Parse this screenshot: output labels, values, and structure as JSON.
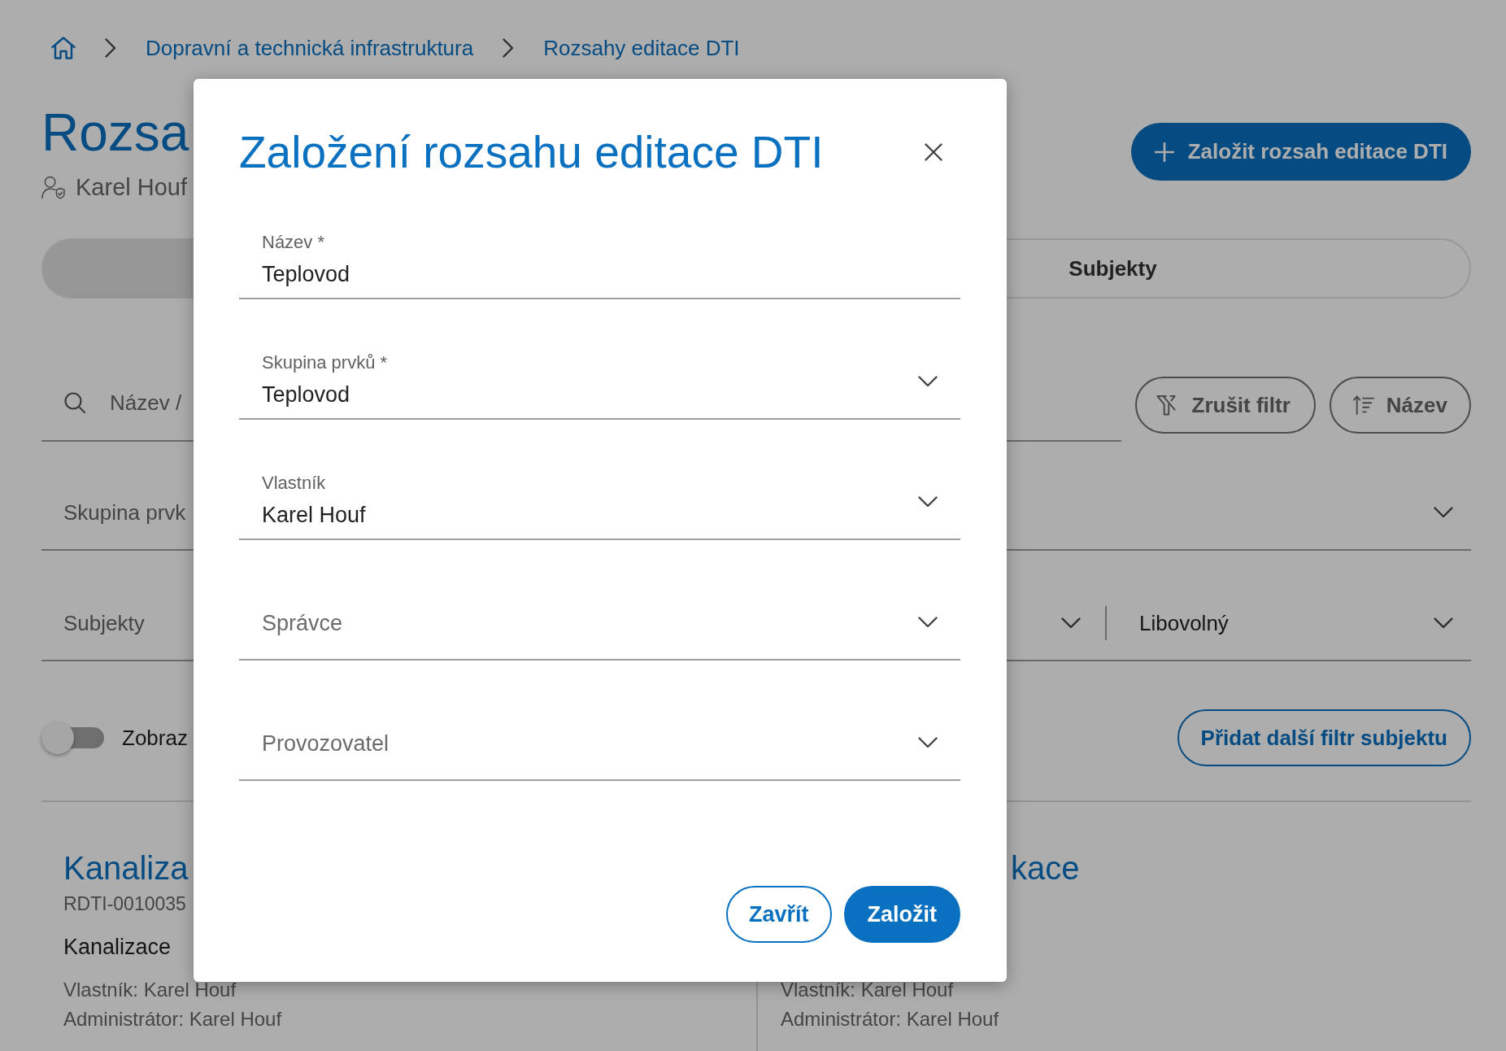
{
  "breadcrumb": [
    {
      "kind": "home"
    },
    {
      "kind": "link",
      "label": "Dopravní a technická infrastruktura"
    },
    {
      "kind": "link",
      "label": "Rozsahy editace DTI"
    }
  ],
  "header": {
    "title": "Rozsa",
    "owner": "Karel Houf",
    "create_button": "Založit rozsah editace DTI"
  },
  "tabs": [
    {
      "selected": true
    },
    {
      "label": "Subjekty",
      "selected": false
    }
  ],
  "search": {
    "placeholder": "Název /"
  },
  "filter_buttons": [
    {
      "kind": "clear-filter",
      "label": "Zrušit filtr"
    },
    {
      "kind": "sort",
      "label": "Název"
    }
  ],
  "filter_rows": [
    [
      {
        "placeholder": "Skupina prvk"
      }
    ],
    [
      {
        "placeholder": "Subjekty"
      },
      {
        "value": "Libovolný"
      }
    ]
  ],
  "toggle": {
    "label": "Zobraz",
    "on": false
  },
  "add_filter_button": "Přidat další filtr subjektu",
  "cards": [
    {
      "title": "Kanaliza",
      "code": "RDTI-0010035",
      "group": "Kanalizace",
      "owner": "Vlastník: Karel Houf",
      "admin": "Administrátor: Karel Houf"
    },
    {
      "title": "kace",
      "owner": "Vlastník: Karel Houf",
      "admin": "Administrátor: Karel Houf"
    }
  ],
  "dialog": {
    "title": "Založení rozsahu editace DTI",
    "fields": [
      {
        "kind": "text",
        "label": "Název *",
        "value": "Teplovod"
      },
      {
        "kind": "select",
        "label": "Skupina prvků *",
        "value": "Teplovod"
      },
      {
        "kind": "select",
        "label": "Vlastník",
        "value": "Karel Houf"
      },
      {
        "kind": "select",
        "placeholder": "Správce"
      },
      {
        "kind": "select",
        "placeholder": "Provozovatel"
      }
    ],
    "buttons": [
      {
        "kind": "secondary",
        "label": "Zavřít"
      },
      {
        "kind": "primary",
        "label": "Založit"
      }
    ]
  }
}
